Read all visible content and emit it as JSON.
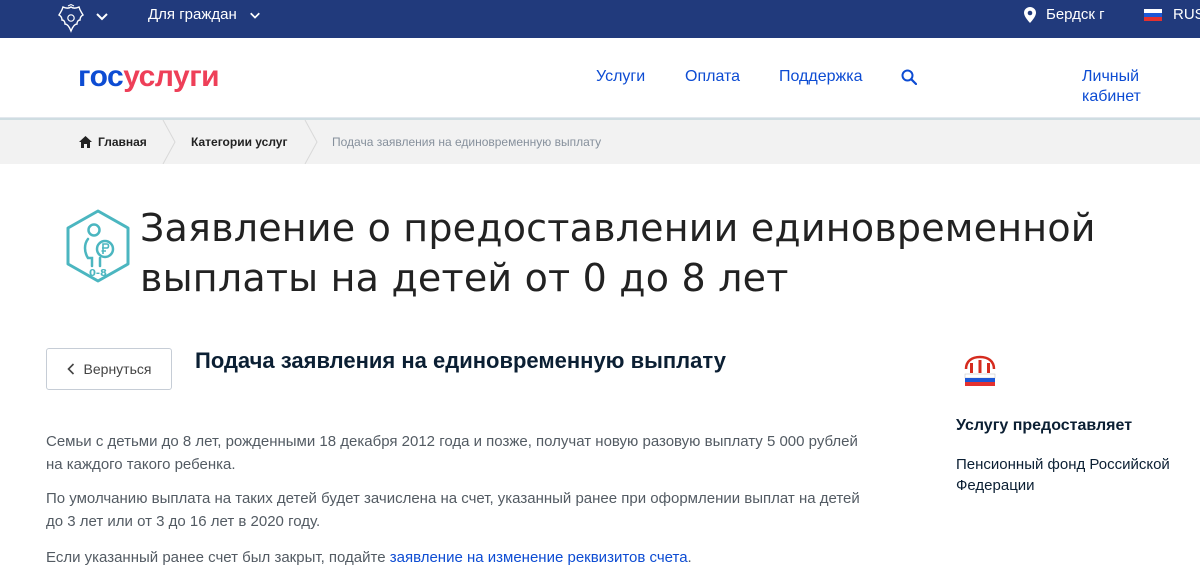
{
  "topbar": {
    "for_citizens": "Для граждан",
    "city": "Бердск г",
    "lang": "RUS"
  },
  "header": {
    "logo_part1": "гос",
    "logo_part2": "услуги",
    "nav": [
      "Услуги",
      "Оплата",
      "Поддержка"
    ],
    "account": "Личный кабинет"
  },
  "breadcrumbs": {
    "home": "Главная",
    "category": "Категории услуг",
    "current": "Подача заявления на единовременную выплату"
  },
  "page": {
    "title": "Заявление о предоставлении единовременной выплаты на детей от 0 до 8 лет",
    "icon_label": "0-8",
    "back": "Вернуться",
    "subtitle": "Подача заявления на единовременную выплату",
    "paragraphs": [
      "Семьи с детьми до 8 лет, рожденными 18 декабря 2012 года и позже, получат новую разовую выплату 5 000 рублей на каждого такого ребенка.",
      "По умолчанию выплата на таких детей будет зачислена на счет, указанный ранее при оформлении выплат на детей до 3 лет или от 3 до 16 лет в 2020 году."
    ],
    "para3_text": "Если указанный ранее счет был закрыт, подайте ",
    "para3_link": "заявление на изменение реквизитов счета",
    "para3_end": "."
  },
  "aside": {
    "heading": "Услугу предоставляет",
    "org": "Пенсионный фонд Российской Федерации"
  },
  "colors": {
    "topbar": "#213a7c",
    "brand_blue": "#0d4cd3",
    "brand_red": "#ee3f58",
    "icon_teal": "#4bb6c0"
  },
  "icons": [
    "emblem-icon",
    "chevron-down-icon",
    "location-pin-icon",
    "flag-ru-icon",
    "search-icon",
    "home-icon",
    "child-payment-icon",
    "chevron-left-icon",
    "pfr-logo-icon"
  ]
}
